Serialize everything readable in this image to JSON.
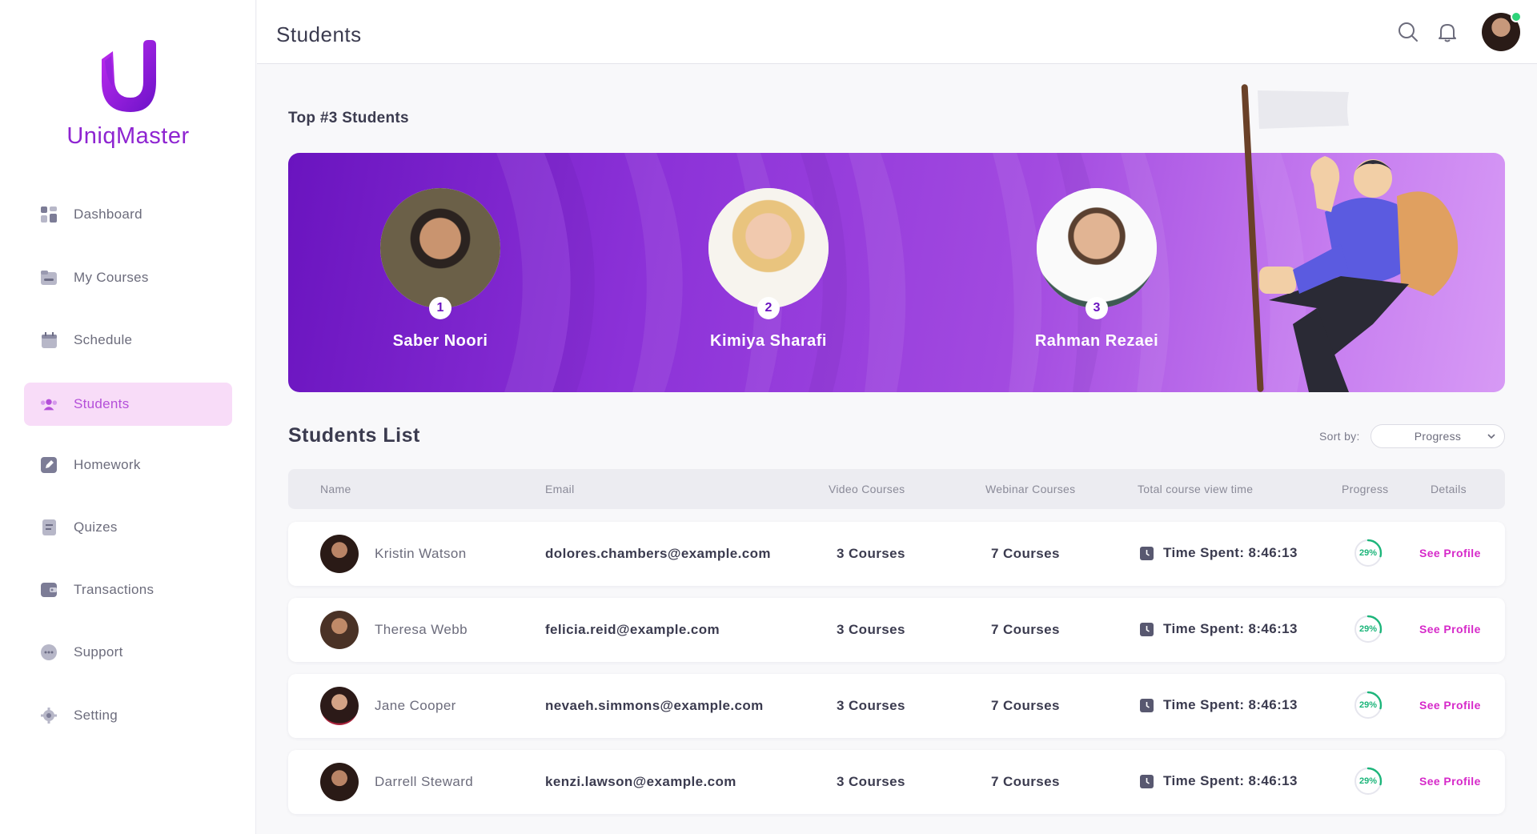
{
  "app": {
    "name": "UniqMaster"
  },
  "colors": {
    "brand": "#8e24d1",
    "active_bg": "#f8dcf8",
    "link": "#d629c9",
    "progress": "#1cb57a"
  },
  "sidebar": {
    "items": [
      {
        "label": "Dashboard",
        "icon": "dashboard-icon"
      },
      {
        "label": "My Courses",
        "icon": "folder-icon"
      },
      {
        "label": "Schedule",
        "icon": "calendar-icon"
      },
      {
        "label": "Students",
        "icon": "students-icon",
        "active": true
      },
      {
        "label": "Homework",
        "icon": "edit-icon"
      },
      {
        "label": "Quizes",
        "icon": "document-icon"
      },
      {
        "label": "Transactions",
        "icon": "wallet-icon"
      },
      {
        "label": "Support",
        "icon": "chat-icon"
      },
      {
        "label": "Setting",
        "icon": "gear-icon"
      }
    ]
  },
  "header": {
    "title": "Students",
    "icons": [
      "search-icon",
      "bell-icon"
    ]
  },
  "top_students": {
    "title": "Top #3 Students",
    "students": [
      {
        "rank": "1",
        "name": "Saber Noori"
      },
      {
        "rank": "2",
        "name": "Kimiya Sharafi"
      },
      {
        "rank": "3",
        "name": "Rahman Rezaei"
      }
    ]
  },
  "students_list": {
    "title": "Students List",
    "sort_label": "Sort by:",
    "sort_value": "Progress",
    "columns": [
      "Name",
      "Email",
      "Video Courses",
      "Webinar Courses",
      "Total course view time",
      "Progress",
      "Details"
    ],
    "rows": [
      {
        "name": "Kristin Watson",
        "email": "dolores.chambers@example.com",
        "video": "3 Courses",
        "webinar": "7 Courses",
        "time": "Time Spent: 8:46:13",
        "progress": "29%",
        "progress_value": 0.29,
        "link": "See Profile"
      },
      {
        "name": "Theresa Webb",
        "email": "felicia.reid@example.com",
        "video": "3 Courses",
        "webinar": "7 Courses",
        "time": "Time Spent: 8:46:13",
        "progress": "29%",
        "progress_value": 0.29,
        "link": "See Profile"
      },
      {
        "name": "Jane Cooper",
        "email": "nevaeh.simmons@example.com",
        "video": "3 Courses",
        "webinar": "7 Courses",
        "time": "Time Spent: 8:46:13",
        "progress": "29%",
        "progress_value": 0.29,
        "link": "See Profile"
      },
      {
        "name": "Darrell Steward",
        "email": "kenzi.lawson@example.com",
        "video": "3 Courses",
        "webinar": "7 Courses",
        "time": "Time Spent: 8:46:13",
        "progress": "29%",
        "progress_value": 0.29,
        "link": "See Profile"
      }
    ]
  }
}
